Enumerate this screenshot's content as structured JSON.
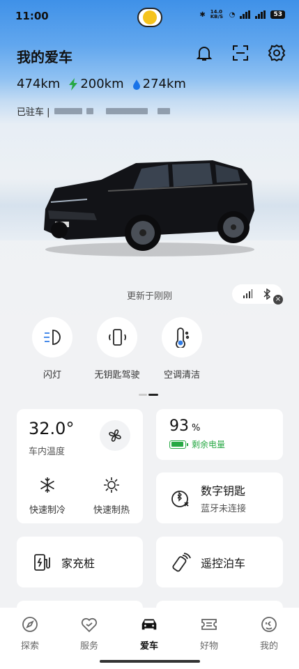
{
  "status": {
    "time": "11:00",
    "net_speed": "14.0 KB/S",
    "battery": "53"
  },
  "header": {
    "title": "我的爱车"
  },
  "icons": {
    "bell": "bell-icon",
    "scan": "scan-icon",
    "settings": "gear-icon"
  },
  "ranges": {
    "total": "474km",
    "electric": "200km",
    "fuel": "274km",
    "electric_color": "#27a844",
    "fuel_color": "#1a73e8"
  },
  "parked": {
    "label": "已驻车 |"
  },
  "update": {
    "text": "更新于刚刚"
  },
  "quick_actions": [
    {
      "label": "闪灯",
      "icon": "headlight-flash-icon"
    },
    {
      "label": "无钥匙驾驶",
      "icon": "phone-key-icon"
    },
    {
      "label": "空调清洁",
      "icon": "ac-clean-icon"
    }
  ],
  "climate": {
    "temperature": "32.0°",
    "temp_label": "车内温度",
    "cool_label": "快速制冷",
    "heat_label": "快速制热"
  },
  "battery": {
    "percent": "93",
    "unit": "%",
    "label": "剩余电量",
    "level": 0.93
  },
  "digital_key": {
    "title": "数字钥匙",
    "status": "蓝牙未连接"
  },
  "charger": {
    "label": "家充桩"
  },
  "parking": {
    "label": "遥控泊车"
  },
  "tabs": [
    {
      "label": "探索",
      "icon": "explore-icon"
    },
    {
      "label": "服务",
      "icon": "service-icon"
    },
    {
      "label": "爱车",
      "icon": "car-icon",
      "active": true
    },
    {
      "label": "好物",
      "icon": "ticket-icon"
    },
    {
      "label": "我的",
      "icon": "profile-icon"
    }
  ]
}
